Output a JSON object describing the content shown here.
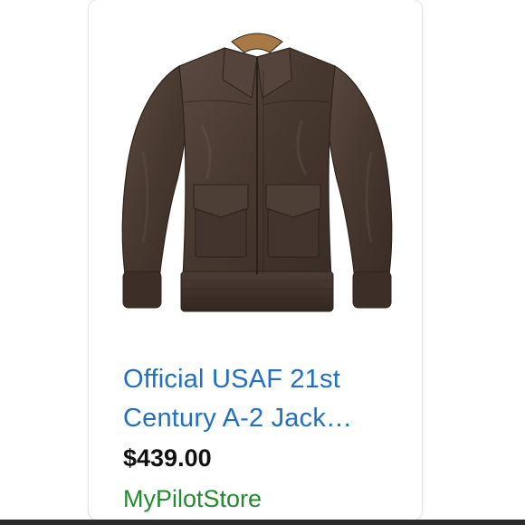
{
  "product": {
    "image_icon": "leather-bomber-jacket-image",
    "title_line1": "Official USAF 21st",
    "title_line2": "Century A-2 Jack…",
    "price": "$439.00",
    "store": "MyPilotStore"
  },
  "colors": {
    "title": "#1f6fc5",
    "price": "#111111",
    "store": "#238a2f",
    "jacket": "#4a3a32"
  }
}
